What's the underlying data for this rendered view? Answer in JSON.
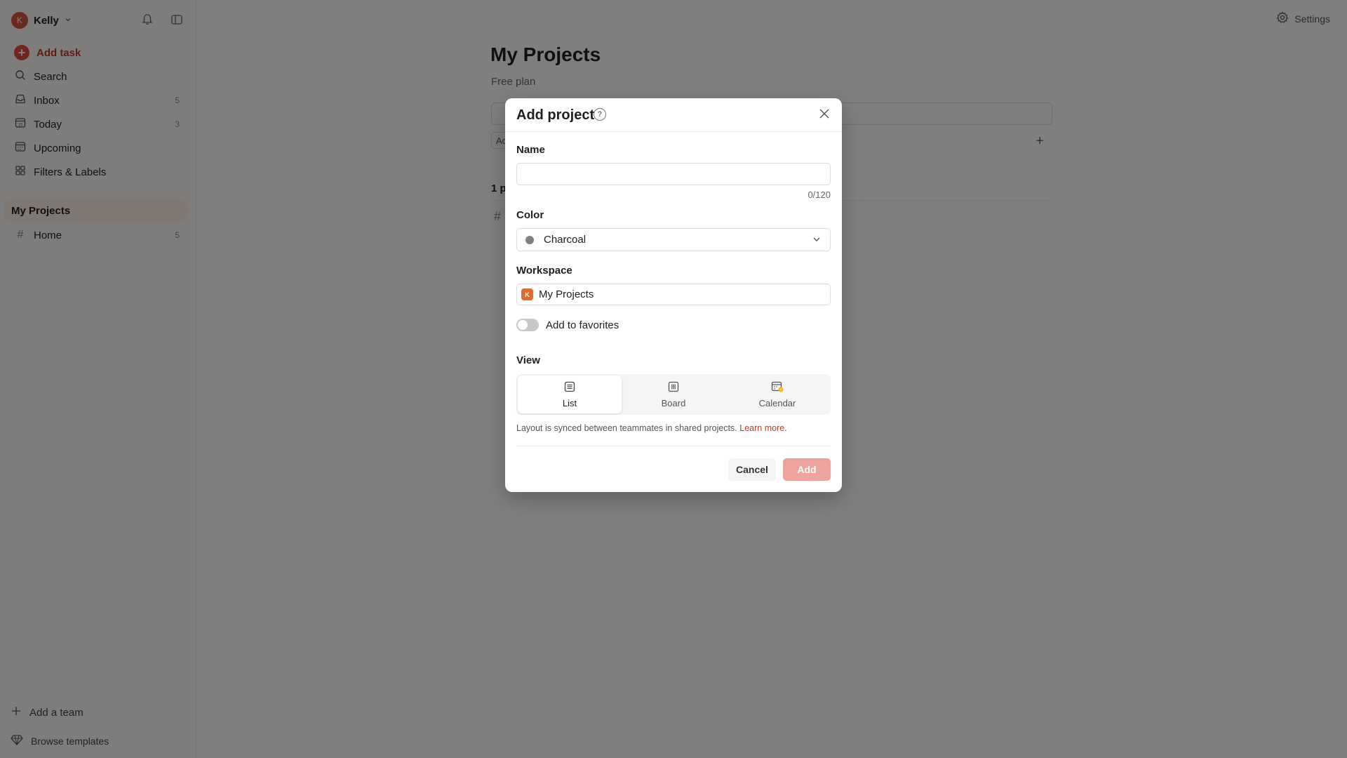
{
  "sidebar": {
    "user": {
      "initial": "K",
      "name": "Kelly"
    },
    "add_task": "Add task",
    "items": [
      {
        "label": "Search",
        "count": ""
      },
      {
        "label": "Inbox",
        "count": "5"
      },
      {
        "label": "Today",
        "count": "3"
      },
      {
        "label": "Upcoming",
        "count": ""
      },
      {
        "label": "Filters & Labels",
        "count": ""
      }
    ],
    "section_title": "My Projects",
    "projects": [
      {
        "label": "Home",
        "count": "5"
      }
    ],
    "add_team": "Add a team",
    "browse_templates": "Browse templates"
  },
  "header": {
    "settings": "Settings"
  },
  "main": {
    "title": "My Projects",
    "subtitle": "Free plan",
    "filter_chip": "Ac",
    "project_count": "1 p"
  },
  "modal": {
    "title": "Add project",
    "name_label": "Name",
    "name_value": "",
    "char_count": "0/120",
    "color_label": "Color",
    "color_value": "Charcoal",
    "color_hex": "#808080",
    "workspace_label": "Workspace",
    "workspace_initial": "K",
    "workspace_value": "My Projects",
    "favorites_label": "Add to favorites",
    "favorites_on": false,
    "view_label": "View",
    "views": [
      {
        "label": "List",
        "icon": "list-icon",
        "active": true
      },
      {
        "label": "Board",
        "icon": "board-icon",
        "active": false
      },
      {
        "label": "Calendar",
        "icon": "calendar-icon",
        "active": false
      }
    ],
    "layout_note": "Layout is synced between teammates in shared projects.",
    "learn_more": "Learn more.",
    "cancel": "Cancel",
    "add": "Add"
  },
  "colors": {
    "accent": "#dc4c3e",
    "add_disabled": "#eea49c",
    "section_bg": "#ffefe5"
  }
}
